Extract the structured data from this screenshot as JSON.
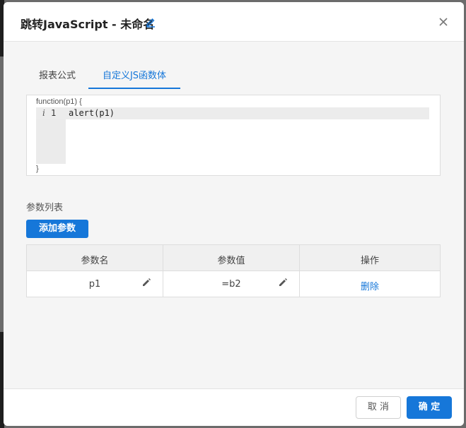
{
  "dialog": {
    "title": "跳转JavaScript - 未命名"
  },
  "tabs": [
    {
      "label": "报表公式",
      "active": false
    },
    {
      "label": "自定义JS函数体",
      "active": true
    }
  ],
  "editor": {
    "header": "function(p1) {",
    "footer": "}",
    "line_marker": "i",
    "line_number": "1",
    "code": "alert(p1)"
  },
  "params": {
    "section_label": "参数列表",
    "add_button": "添加参数",
    "columns": [
      "参数名",
      "参数值",
      "操作"
    ],
    "rows": [
      {
        "name": "p1",
        "value": "=b2",
        "action": "删除"
      }
    ]
  },
  "footer": {
    "cancel_label": "取 消",
    "ok_label": "确 定"
  },
  "colors": {
    "accent": "#1677d9"
  }
}
